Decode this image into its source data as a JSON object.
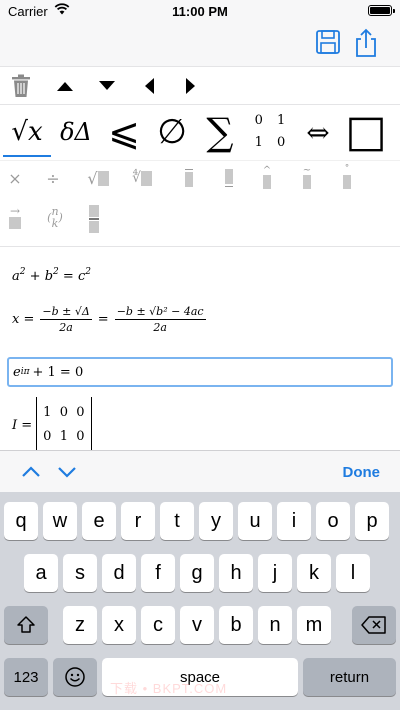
{
  "status_bar": {
    "carrier": "Carrier",
    "time": "11:00 PM"
  },
  "nav_bar": {
    "save_icon": "save-icon",
    "share_icon": "share-icon",
    "accent": "#1f7ce0"
  },
  "toolbar": {
    "icons": [
      "trash-icon",
      "arrow-up-icon",
      "arrow-down-icon",
      "arrow-left-icon",
      "arrow-right-icon"
    ]
  },
  "categories": {
    "selected": "sqrt",
    "items": [
      {
        "id": "sqrt",
        "label": "√x"
      },
      {
        "id": "greek",
        "label": "δΔ"
      },
      {
        "id": "relations",
        "label": "⩽"
      },
      {
        "id": "sets",
        "label": "∅"
      },
      {
        "id": "operators",
        "label": "∑"
      },
      {
        "id": "matrix",
        "label": "0 1 1 0"
      },
      {
        "id": "arrows",
        "label": "⇔"
      },
      {
        "id": "box",
        "label": "□"
      }
    ]
  },
  "palette": {
    "row1": [
      "×",
      "÷",
      "√",
      "∜",
      "overline",
      "underline",
      "hat",
      "tilde",
      "dot"
    ],
    "row2": [
      "vector",
      "binomial",
      "underbox"
    ],
    "binomial_top": "n",
    "binomial_bottom": "k"
  },
  "editor": {
    "eq1": {
      "a": "a",
      "exp1": "2",
      "plus": "+",
      "b": "b",
      "exp2": "2",
      "eq": "=",
      "c": "c",
      "exp3": "2"
    },
    "eq2": {
      "lhs": "x =",
      "num1": "−b ± √Δ",
      "den1": "2a",
      "eq": "=",
      "num2": "−b ± √b² − 4ac",
      "den2": "2a"
    },
    "eq3": {
      "base": "e",
      "exp": "iπ",
      "rest": "+ 1 = 0"
    },
    "eq4": {
      "lhs": "I =",
      "rows": [
        "1  0  0",
        "0  1  0"
      ]
    }
  },
  "accessory": {
    "done_label": "Done"
  },
  "keyboard": {
    "row1": [
      "q",
      "w",
      "e",
      "r",
      "t",
      "y",
      "u",
      "i",
      "o",
      "p"
    ],
    "row2": [
      "a",
      "s",
      "d",
      "f",
      "g",
      "h",
      "j",
      "k",
      "l"
    ],
    "row3": [
      "z",
      "x",
      "c",
      "v",
      "b",
      "n",
      "m"
    ],
    "numbers_label": "123",
    "space_label": "space",
    "return_label": "return"
  },
  "watermark": "下载 • BKPT.COM"
}
